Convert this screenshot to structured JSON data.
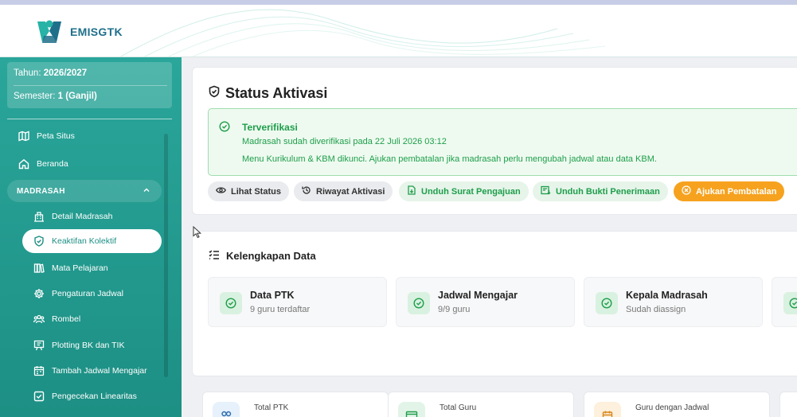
{
  "app": {
    "logo_text": "EMISGTK"
  },
  "sidebar": {
    "year_label": "Tahun:",
    "year_value": "2026/2027",
    "semester_label": "Semester:",
    "semester_value": "1 (Ganjil)",
    "top_items": [
      {
        "label": "Peta Situs",
        "icon": "map-icon"
      },
      {
        "label": "Beranda",
        "icon": "home-icon"
      }
    ],
    "section": {
      "label": "MADRASAH",
      "icon": "chevron-up-icon"
    },
    "sub_items": [
      {
        "label": "Detail Madrasah",
        "icon": "building-icon"
      },
      {
        "label": "Keaktifan Kolektif",
        "icon": "shield-check-icon",
        "active": true
      },
      {
        "label": "Mata Pelajaran",
        "icon": "books-icon"
      },
      {
        "label": "Pengaturan Jadwal",
        "icon": "gear-icon"
      },
      {
        "label": "Rombel",
        "icon": "group-icon"
      },
      {
        "label": "Plotting BK dan TIK",
        "icon": "presentation-icon"
      },
      {
        "label": "Tambah Jadwal Mengajar",
        "icon": "calendar-icon"
      },
      {
        "label": "Pengecekan Linearitas",
        "icon": "checkbox-icon"
      }
    ]
  },
  "status": {
    "title": "Status Aktivasi",
    "alert_title": "Terverifikasi",
    "alert_line1": "Madrasah sudah diverifikasi pada 22 Juli 2026 03:12",
    "alert_line2": "Menu Kurikulum & KBM dikunci. Ajukan pembatalan jika madrasah perlu mengubah jadwal atau data KBM.",
    "buttons": [
      {
        "label": "Lihat Status",
        "icon": "eye-icon"
      },
      {
        "label": "Riwayat Aktivasi",
        "icon": "history-icon"
      },
      {
        "label": "Unduh Surat Pengajuan",
        "icon": "document-download-icon"
      },
      {
        "label": "Unduh Bukti Penerimaan",
        "icon": "receipt-download-icon"
      },
      {
        "label": "Ajukan Pembatalan",
        "icon": "cancel-circle-icon"
      }
    ]
  },
  "kelengkapan": {
    "title": "Kelengkapan Data",
    "items": [
      {
        "name": "Data PTK",
        "sub": "9 guru terdaftar"
      },
      {
        "name": "Jadwal Mengajar",
        "sub": "9/9 guru"
      },
      {
        "name": "Kepala Madrasah",
        "sub": "Sudah diassign"
      }
    ]
  },
  "stats": [
    {
      "label": "Total PTK",
      "icon": "users-icon",
      "color": "#e6f1fb"
    },
    {
      "label": "Total Guru",
      "icon": "id-card-icon",
      "color": "#e2f4e8"
    },
    {
      "label": "Guru dengan Jadwal",
      "icon": "calendar-icon",
      "color": "#fdf0dc"
    }
  ],
  "colors": {
    "accent": "#1d8f84",
    "success": "#1e9e4a",
    "warning": "#f6a21e"
  }
}
